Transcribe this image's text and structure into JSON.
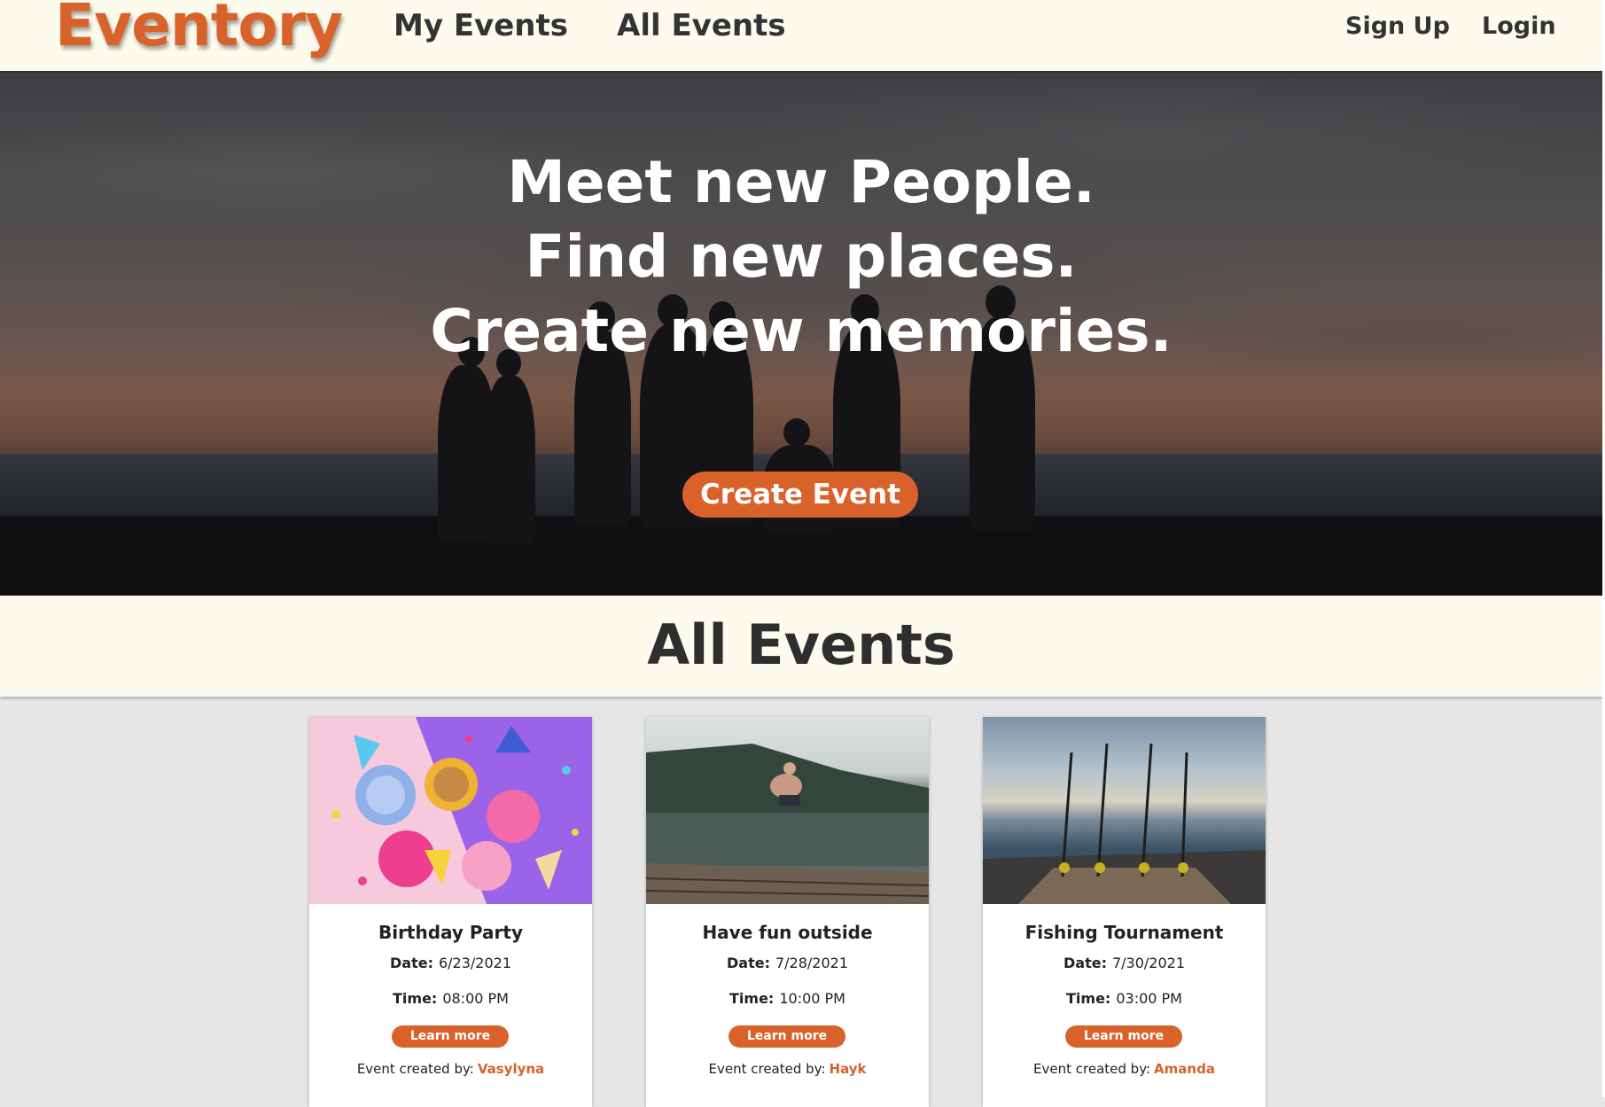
{
  "nav": {
    "brand": "Eventory",
    "my_events": "My Events",
    "all_events": "All Events",
    "sign_up": "Sign Up",
    "login": "Login"
  },
  "hero": {
    "line1": "Meet new People.",
    "line2": "Find new places.",
    "line3": "Create new memories.",
    "create_button": "Create Event"
  },
  "section": {
    "title": "All Events"
  },
  "events": [
    {
      "title": "Birthday Party",
      "date_label": "Date:",
      "date": "6/23/2021",
      "time_label": "Time:",
      "time": "08:00 PM",
      "button": "Learn more",
      "created_by_label": "Event created by:",
      "creator": "Vasylyna"
    },
    {
      "title": "Have fun outside",
      "date_label": "Date:",
      "date": "7/28/2021",
      "time_label": "Time:",
      "time": "10:00 PM",
      "button": "Learn more",
      "created_by_label": "Event created by:",
      "creator": "Hayk"
    },
    {
      "title": "Fishing Tournament",
      "date_label": "Date:",
      "date": "7/30/2021",
      "time_label": "Time:",
      "time": "03:00 PM",
      "button": "Learn more",
      "created_by_label": "Event created by:",
      "creator": "Amanda"
    }
  ],
  "colors": {
    "accent": "#d9622b",
    "nav_bg": "#fdfbee",
    "page_bg": "#e6e6e6"
  }
}
